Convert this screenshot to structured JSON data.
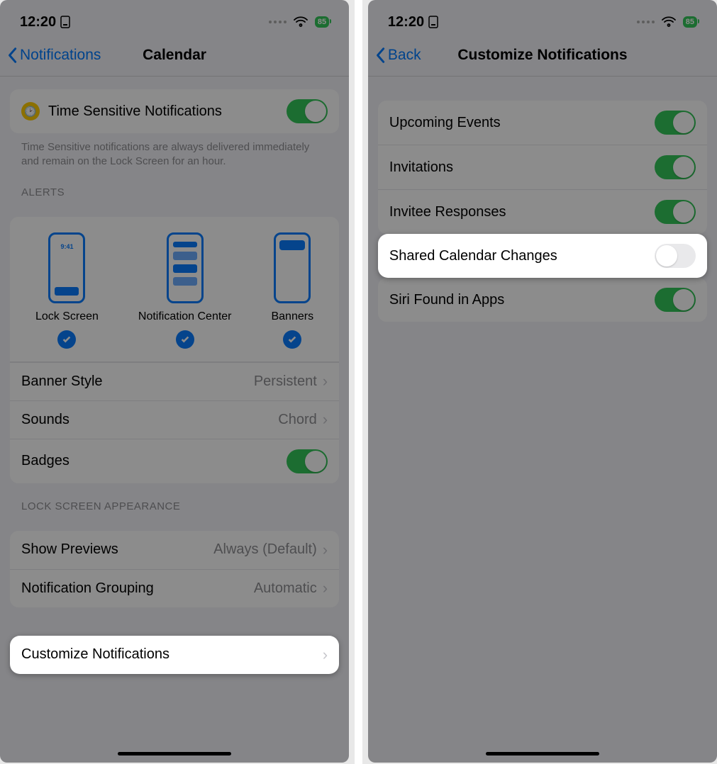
{
  "status": {
    "time": "12:20",
    "battery": "85"
  },
  "left": {
    "back": "Notifications",
    "title": "Calendar",
    "tsn_icon_time": "9:41",
    "tsn_label": "Time Sensitive Notifications",
    "tsn_footer": "Time Sensitive notifications are always delivered immediately and remain on the Lock Screen for an hour.",
    "alerts_header": "ALERTS",
    "alert_lock": "Lock Screen",
    "alert_nc": "Notification Center",
    "alert_banner": "Banners",
    "banner_style_label": "Banner Style",
    "banner_style_value": "Persistent",
    "sounds_label": "Sounds",
    "sounds_value": "Chord",
    "badges_label": "Badges",
    "lsa_header": "LOCK SCREEN APPEARANCE",
    "previews_label": "Show Previews",
    "previews_value": "Always (Default)",
    "grouping_label": "Notification Grouping",
    "grouping_value": "Automatic",
    "customize_label": "Customize Notifications"
  },
  "right": {
    "back": "Back",
    "title": "Customize Notifications",
    "items": [
      {
        "label": "Upcoming Events",
        "on": true
      },
      {
        "label": "Invitations",
        "on": true
      },
      {
        "label": "Invitee Responses",
        "on": true
      },
      {
        "label": "Shared Calendar Changes",
        "on": false
      },
      {
        "label": "Siri Found in Apps",
        "on": true
      }
    ]
  }
}
